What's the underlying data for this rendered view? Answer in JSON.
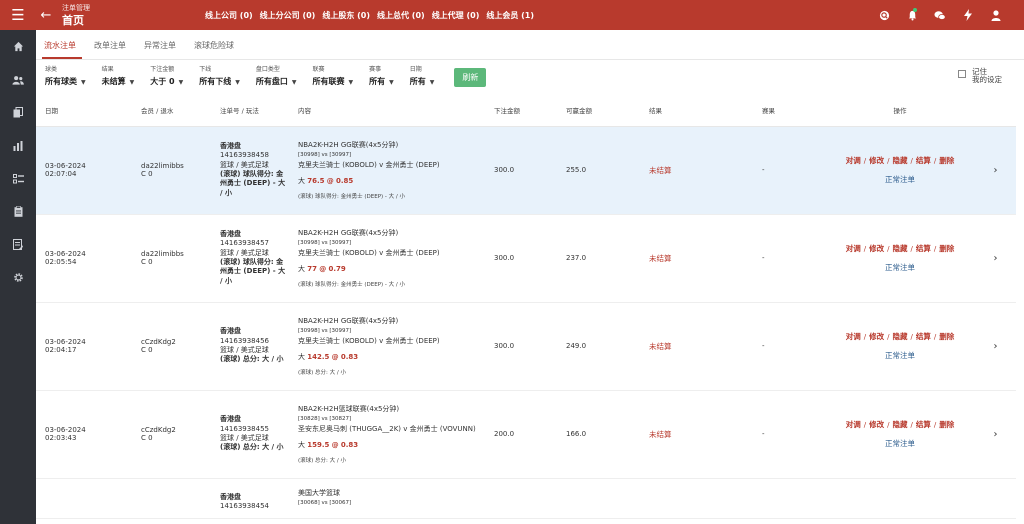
{
  "header": {
    "breadcrumb_sup": "注单管理",
    "title": "首页",
    "nav": [
      "线上公司 (0)",
      "线上分公司 (0)",
      "线上股东 (0)",
      "线上总代 (0)",
      "线上代理 (0)",
      "线上会员 (1)"
    ]
  },
  "tabs": [
    "流水注单",
    "改单注单",
    "异常注单",
    "滚球危险球"
  ],
  "filters": [
    {
      "label": "球类",
      "value": "所有球类"
    },
    {
      "label": "结果",
      "value": "未结算"
    },
    {
      "label": "下注金额",
      "value": "大于 0"
    },
    {
      "label": "下线",
      "value": "所有下线"
    },
    {
      "label": "盘口类型",
      "value": "所有盘口"
    },
    {
      "label": "联赛",
      "value": "所有联赛"
    },
    {
      "label": "赛事",
      "value": "所有"
    },
    {
      "label": "日期",
      "value": "所有"
    }
  ],
  "refresh_label": "刷新",
  "remember_label": "记住\n我的设定",
  "columns": [
    "日期",
    "会员 / 退水",
    "注单号 / 玩法",
    "内容",
    "下注金额",
    "可赢金额",
    "结果",
    "赛果",
    "操作"
  ],
  "action_labels": [
    "对调",
    "修改",
    "隐藏",
    "结算",
    "删除"
  ],
  "normal_label": "正常注单",
  "rows": [
    {
      "date": "03-06-2024",
      "time": "02:07:04",
      "member": "da22limibbs",
      "rebate": "C 0",
      "market": "香港盘",
      "order_no": "14163938458",
      "sport": "篮球 / 美式足球",
      "bet_type": "(滚球) 球队得分: 金州勇士 (DEEP) - 大 / 小",
      "league": "NBA2K-H2H GG联赛(4x5分钟)",
      "ids": "[30998] vs [30997]",
      "match": "克里夫兰骑士 (KOBOLD) v 金州勇士 (DEEP)",
      "pick_prefix": "大",
      "line": "76.5",
      "at": "@",
      "odds": "0.85",
      "detail": "(滚球) 球队得分: 金州勇士 (DEEP) - 大 / 小",
      "amount": "300.0",
      "win": "255.0",
      "result": "未结算",
      "score": "-"
    },
    {
      "date": "03-06-2024",
      "time": "02:05:54",
      "member": "da22limibbs",
      "rebate": "C 0",
      "market": "香港盘",
      "order_no": "14163938457",
      "sport": "篮球 / 美式足球",
      "bet_type": "(滚球) 球队得分: 金州勇士 (DEEP) - 大 / 小",
      "league": "NBA2K-H2H GG联赛(4x5分钟)",
      "ids": "[30998] vs [30997]",
      "match": "克里夫兰骑士 (KOBOLD) v 金州勇士 (DEEP)",
      "pick_prefix": "大",
      "line": "77",
      "at": "@",
      "odds": "0.79",
      "detail": "(滚球) 球队得分: 金州勇士 (DEEP) - 大 / 小",
      "amount": "300.0",
      "win": "237.0",
      "result": "未结算",
      "score": "-"
    },
    {
      "date": "03-06-2024",
      "time": "02:04:17",
      "member": "cCzdKdg2",
      "rebate": "C 0",
      "market": "香港盘",
      "order_no": "14163938456",
      "sport": "篮球 / 美式足球",
      "bet_type": "(滚球) 总分: 大 / 小",
      "league": "NBA2K-H2H GG联赛(4x5分钟)",
      "ids": "[30998] vs [30997]",
      "match": "克里夫兰骑士 (KOBOLD) v 金州勇士 (DEEP)",
      "pick_prefix": "大",
      "line": "142.5",
      "at": "@",
      "odds": "0.83",
      "detail": "(滚球) 总分: 大 / 小",
      "amount": "300.0",
      "win": "249.0",
      "result": "未结算",
      "score": "-"
    },
    {
      "date": "03-06-2024",
      "time": "02:03:43",
      "member": "cCzdKdg2",
      "rebate": "C 0",
      "market": "香港盘",
      "order_no": "14163938455",
      "sport": "篮球 / 美式足球",
      "bet_type": "(滚球) 总分: 大 / 小",
      "league": "NBA2K-H2H篮球联赛(4x5分钟)",
      "ids": "[30828] vs [30827]",
      "match": "圣安东尼奥马刺 (THUGGA__2K) v 金州勇士 (VOVUNN)",
      "pick_prefix": "大",
      "line": "159.5",
      "at": "@",
      "odds": "0.83",
      "detail": "(滚球) 总分: 大 / 小",
      "amount": "200.0",
      "win": "166.0",
      "result": "未结算",
      "score": "-"
    }
  ],
  "partial_row": {
    "market": "香港盘",
    "order_no": "14163938454",
    "league": "美国大学篮球",
    "ids": "[30068] vs [30067]"
  },
  "colors": {
    "brand": "#b83a2d",
    "sidebar": "#2f3238",
    "highlight": "#e8f2fb",
    "refresh": "#5cb87a",
    "link": "#2b5b8c"
  },
  "icons": {
    "topbar": [
      "menu-icon",
      "back-arrow-icon",
      "search-icon",
      "bell-icon",
      "chat-icon",
      "bolt-icon",
      "user-icon"
    ],
    "sidebar": [
      "home-icon",
      "users-icon",
      "copy-icon",
      "bar-chart-icon",
      "list-icon",
      "clipboard-icon",
      "form-icon",
      "gear-icon"
    ]
  }
}
